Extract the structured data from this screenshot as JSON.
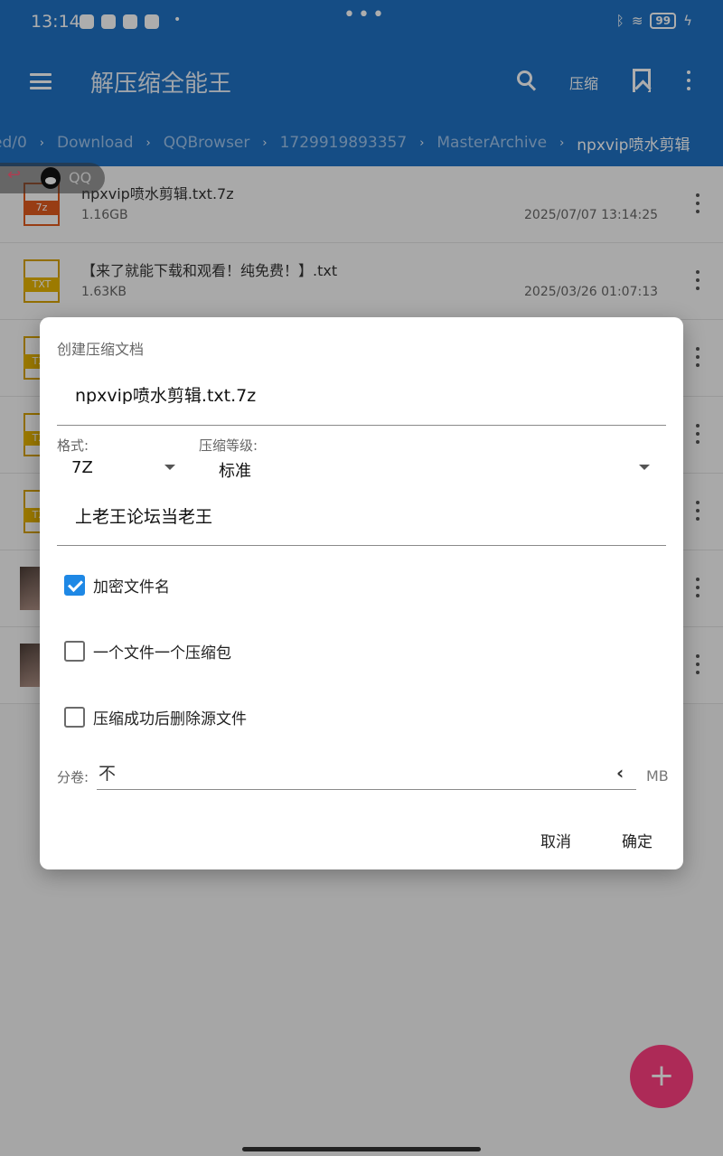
{
  "status_bar": {
    "time": "13:14",
    "dot": "•",
    "center_dots": "•••",
    "battery": "99"
  },
  "app_bar": {
    "title": "解压缩全能王",
    "compress_label": "压缩"
  },
  "breadcrumb": [
    "ed/0",
    "Download",
    "QQBrowser",
    "1729919893357",
    "MasterArchive",
    "npxvip喷水剪辑"
  ],
  "overlay_badge": {
    "text": "QQ"
  },
  "files": [
    {
      "name": "npxvip喷水剪辑.txt.7z",
      "size": "1.16GB",
      "date": "2025/07/07 13:14:25",
      "type": "7z",
      "tag": "7z"
    },
    {
      "name": "【来了就能下载和观看！纯免费！】.txt",
      "size": "1.63KB",
      "date": "2025/03/26 01:07:13",
      "type": "txt",
      "tag": "TXT"
    },
    {
      "type": "txt",
      "tag": "TXT"
    },
    {
      "type": "txt",
      "tag": "TXT"
    },
    {
      "type": "txt",
      "tag": "TXT"
    },
    {
      "type": "image"
    },
    {
      "type": "image"
    }
  ],
  "dialog": {
    "title": "创建压缩文档",
    "archive_name": "npxvip喷水剪辑.txt.7z",
    "format_label": "格式:",
    "format_value": "7Z",
    "level_label": "压缩等级:",
    "level_value": "标准",
    "password": "上老王论坛当老王",
    "options": [
      {
        "label": "加密文件名",
        "checked": true
      },
      {
        "label": "一个文件一个压缩包",
        "checked": false
      },
      {
        "label": "压缩成功后删除源文件",
        "checked": false
      }
    ],
    "volume_label": "分卷:",
    "volume_value": "不",
    "volume_unit": "MB",
    "cancel": "取消",
    "ok": "确定"
  },
  "fab_symbol": "+",
  "colors": {
    "app_bar": "#1f72c4",
    "accent": "#1e88e5",
    "fab": "#ff3f80"
  }
}
